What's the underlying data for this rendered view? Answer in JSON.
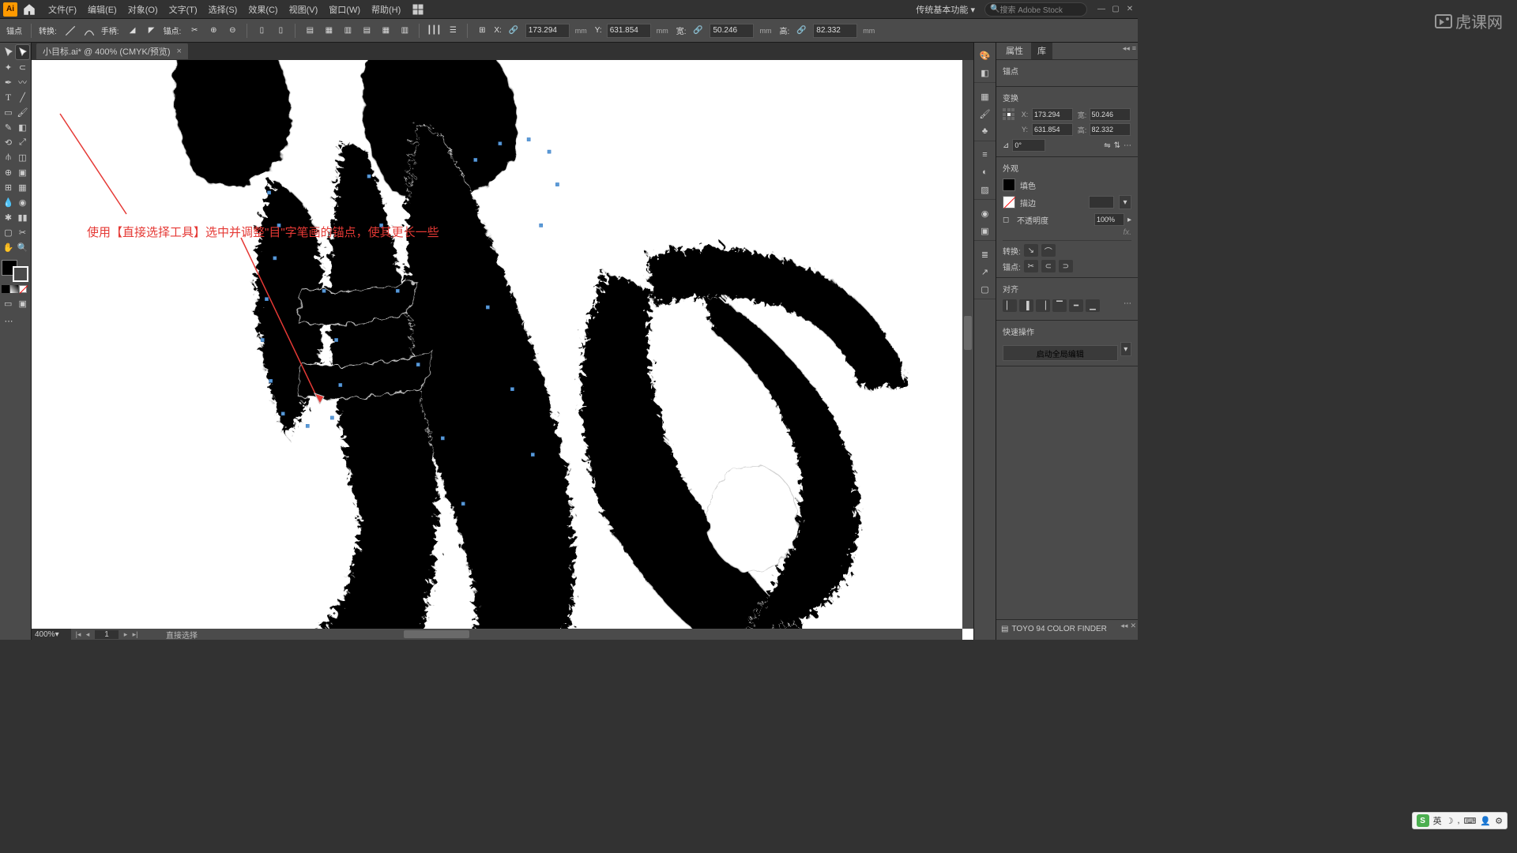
{
  "app": {
    "logo": "Ai"
  },
  "menus": [
    "文件(F)",
    "编辑(E)",
    "对象(O)",
    "文字(T)",
    "选择(S)",
    "效果(C)",
    "视图(V)",
    "窗口(W)",
    "帮助(H)"
  ],
  "workspace": "传统基本功能",
  "adobestock": "搜索 Adobe Stock",
  "controlbar": {
    "anchor_label": "锚点",
    "convert_label": "转换:",
    "handle_label": "手柄:",
    "anchor2_label": "锚点:",
    "x_label": "X:",
    "x_value": "173.294",
    "y_label": "Y:",
    "y_value": "631.854",
    "w_label": "宽:",
    "w_value": "50.246",
    "h_label": "高:",
    "h_value": "82.332",
    "unit": "mm"
  },
  "doc_tab": {
    "title": "小目标.ai* @ 400% (CMYK/预览)"
  },
  "annotation_text": "使用【直接选择工具】选中并调整\"目\"字笔画的锚点，使其更长一些",
  "status": {
    "zoom": "400%",
    "page": "1",
    "tool": "直接选择"
  },
  "panel": {
    "tabs": [
      "属性",
      "库"
    ],
    "anchor_section": "锚点",
    "transform_section": "变换",
    "x": "173.294",
    "y": "631.854",
    "w": "50.246",
    "h": "82.332",
    "unit_w": "宽:",
    "unit_h": "高:",
    "angle": "0°",
    "appearance_section": "外观",
    "fill_label": "填色",
    "stroke_label": "描边",
    "opacity_label": "不透明度",
    "opacity_value": "100%",
    "convert_section": "转换:",
    "anchor_section2": "锚点:",
    "align_section": "对齐",
    "quick_section": "快速操作",
    "quick_btn": "启动全局编辑"
  },
  "swatch_panel": {
    "title": "TOYO 94 COLOR FINDER"
  },
  "ime": {
    "lang": "英",
    "items": [
      "S"
    ]
  },
  "watermark": "虎课网"
}
